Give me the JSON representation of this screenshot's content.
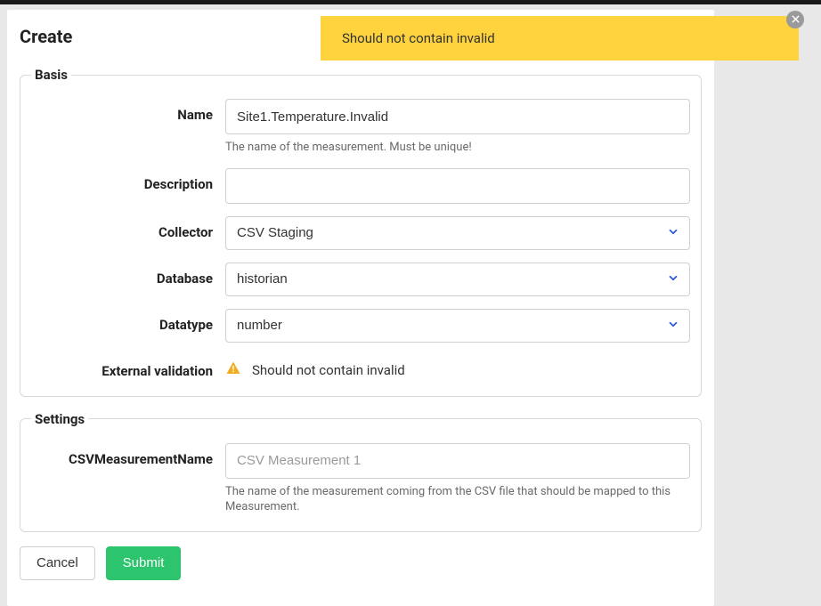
{
  "toast": {
    "message": "Should not contain invalid"
  },
  "panel": {
    "title": "Create"
  },
  "basis": {
    "legend": "Basis",
    "name": {
      "label": "Name",
      "value": "Site1.Temperature.Invalid",
      "help": "The name of the measurement. Must be unique!"
    },
    "description": {
      "label": "Description",
      "value": ""
    },
    "collector": {
      "label": "Collector",
      "value": "CSV Staging"
    },
    "database": {
      "label": "Database",
      "value": "historian"
    },
    "datatype": {
      "label": "Datatype",
      "value": "number"
    },
    "external_validation": {
      "label": "External validation",
      "message": "Should not contain invalid"
    }
  },
  "settings": {
    "legend": "Settings",
    "csv_measurement_name": {
      "label": "CSVMeasurementName",
      "value": "",
      "placeholder": "CSV Measurement 1",
      "help": "The name of the measurement coming from the CSV file that should be mapped to this Measurement."
    }
  },
  "buttons": {
    "cancel": "Cancel",
    "submit": "Submit"
  }
}
